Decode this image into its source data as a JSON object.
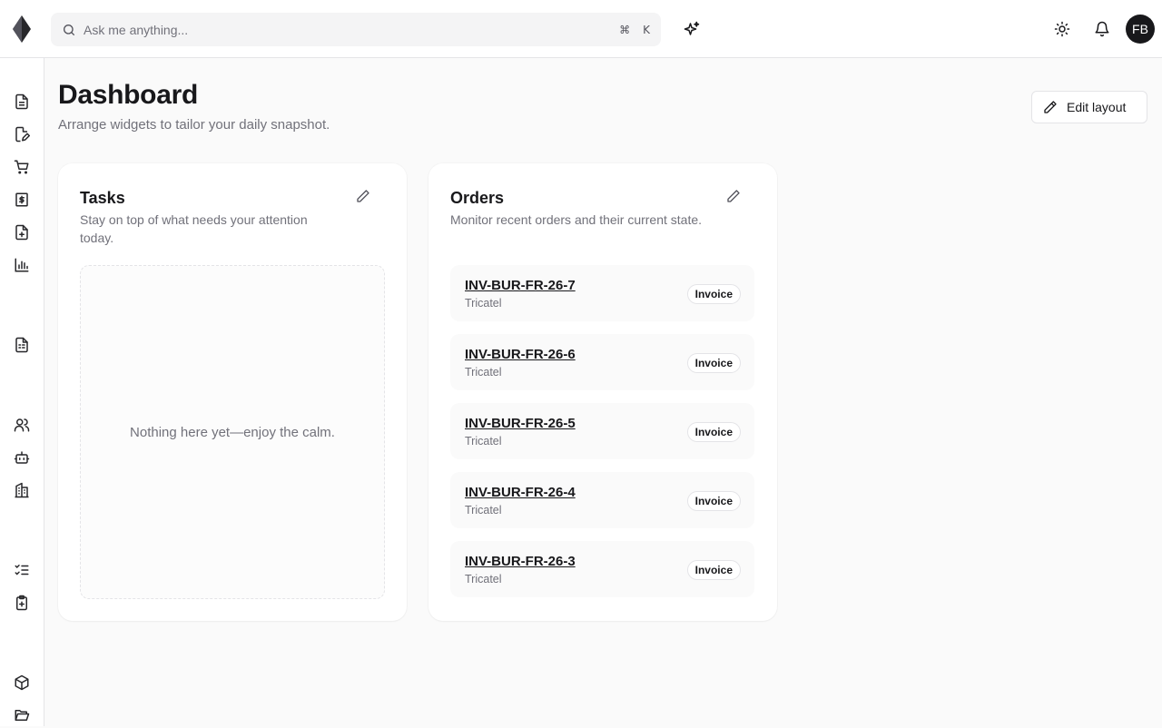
{
  "header": {
    "search_placeholder": "Ask me anything...",
    "shortcut_cmd": "⌘",
    "shortcut_key": "K",
    "avatar_initials": "FB"
  },
  "page": {
    "title": "Dashboard",
    "subtitle": "Arrange widgets to tailor your daily snapshot.",
    "edit_layout_label": "Edit layout"
  },
  "tasks": {
    "title": "Tasks",
    "description": "Stay on top of what needs your attention today.",
    "empty_text": "Nothing here yet—enjoy the calm."
  },
  "orders": {
    "title": "Orders",
    "description": "Monitor recent orders and their current state.",
    "items": [
      {
        "id": "INV-BUR-FR-26-7",
        "company": "Tricatel",
        "type": "Invoice"
      },
      {
        "id": "INV-BUR-FR-26-6",
        "company": "Tricatel",
        "type": "Invoice"
      },
      {
        "id": "INV-BUR-FR-26-5",
        "company": "Tricatel",
        "type": "Invoice"
      },
      {
        "id": "INV-BUR-FR-26-4",
        "company": "Tricatel",
        "type": "Invoice"
      },
      {
        "id": "INV-BUR-FR-26-3",
        "company": "Tricatel",
        "type": "Invoice"
      }
    ]
  },
  "sidebar": {
    "icons": [
      "document-icon",
      "signature-icon",
      "cart-icon",
      "dollar-receipt-icon",
      "file-plus-icon",
      "bar-chart-icon",
      "spreadsheet-icon",
      "users-icon",
      "bot-icon",
      "building-icon",
      "checklist-icon",
      "clipboard-plus-icon",
      "package-icon",
      "folder-open-icon"
    ]
  },
  "colors": {
    "background": "#fafafa",
    "text": "#18181b",
    "muted": "#71717a",
    "border": "#e4e4e7"
  }
}
